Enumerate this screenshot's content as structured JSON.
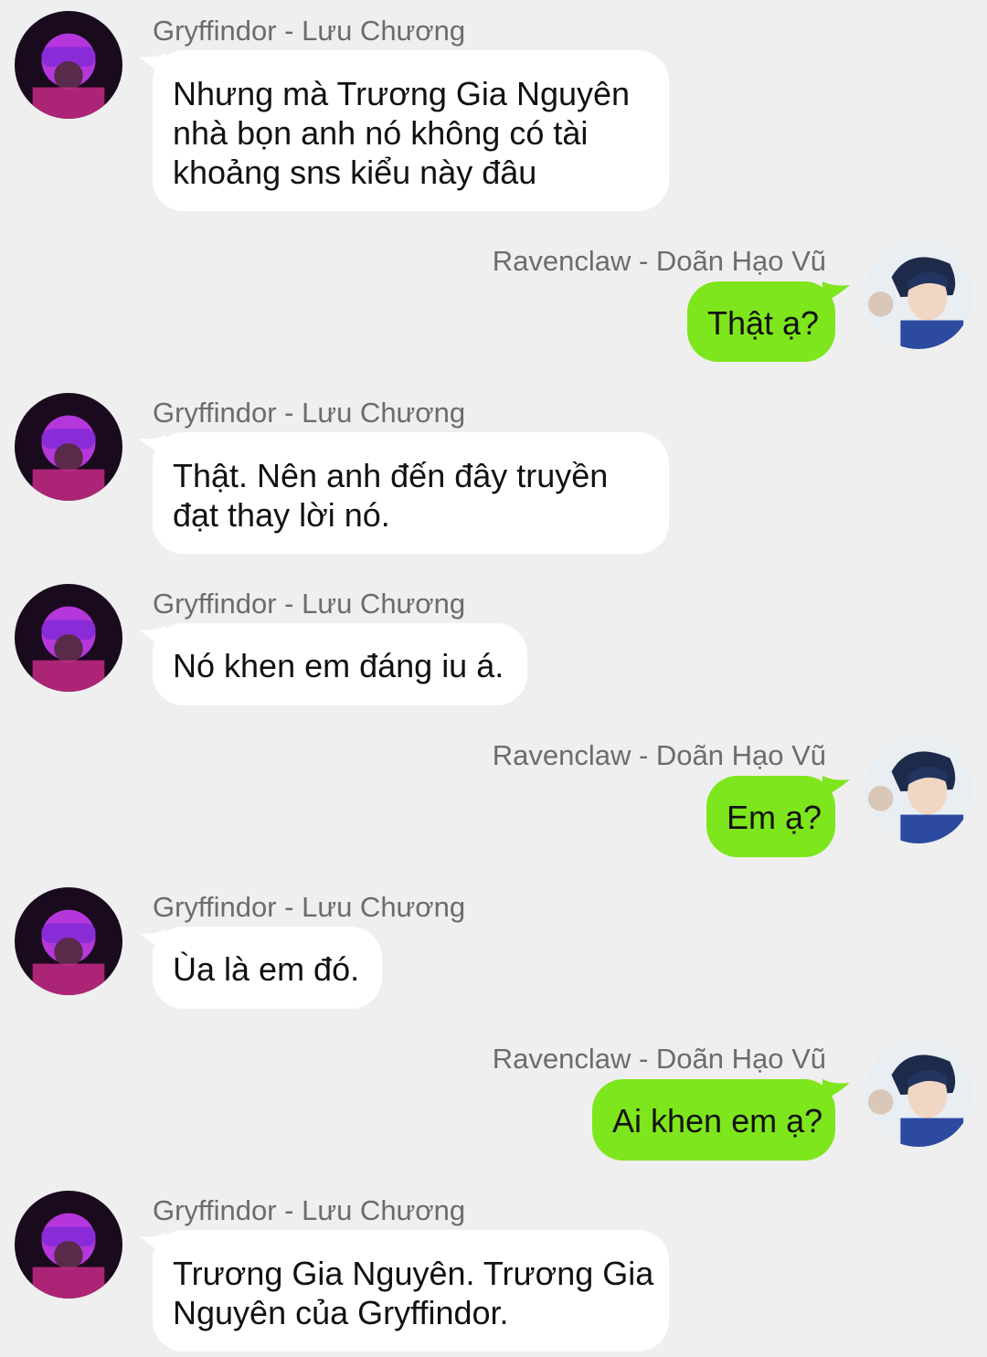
{
  "chat": {
    "messages": [
      {
        "sender": "Gryffindor - Lưu Chương",
        "side": "in",
        "lines": [
          "Nhưng mà Trương Gia Nguyên",
          "nhà bọn anh nó không có tài",
          "khoảng sns kiểu này đâu"
        ]
      },
      {
        "sender": "Ravenclaw - Doãn Hạo Vũ",
        "side": "out",
        "lines": [
          "Thật ạ?"
        ]
      },
      {
        "sender": "Gryffindor - Lưu Chương",
        "side": "in",
        "lines": [
          "Thật. Nên anh đến đây truyền",
          "đạt thay lời nó."
        ]
      },
      {
        "sender": "Gryffindor - Lưu Chương",
        "side": "in",
        "lines": [
          "Nó khen em đáng iu á."
        ]
      },
      {
        "sender": "Ravenclaw - Doãn Hạo Vũ",
        "side": "out",
        "lines": [
          "Em ạ?"
        ]
      },
      {
        "sender": "Gryffindor - Lưu Chương",
        "side": "in",
        "lines": [
          "Ùa là em đó."
        ]
      },
      {
        "sender": "Ravenclaw - Doãn Hạo Vũ",
        "side": "out",
        "lines": [
          "Ai khen em ạ?"
        ]
      },
      {
        "sender": "Gryffindor - Lưu Chương",
        "side": "in",
        "lines": [
          "Trương Gia Nguyên. Trương Gia",
          "Nguyên của Gryffindor."
        ]
      }
    ]
  },
  "colors": {
    "background": "#efefef",
    "incoming_bubble": "#ffffff",
    "outgoing_bubble": "#7ee61c",
    "sender_name": "#6c6c6c"
  },
  "icons": {
    "incoming_avatar": "avatar-hooded-figure-icon",
    "outgoing_avatar": "avatar-dark-hair-portrait-icon"
  }
}
